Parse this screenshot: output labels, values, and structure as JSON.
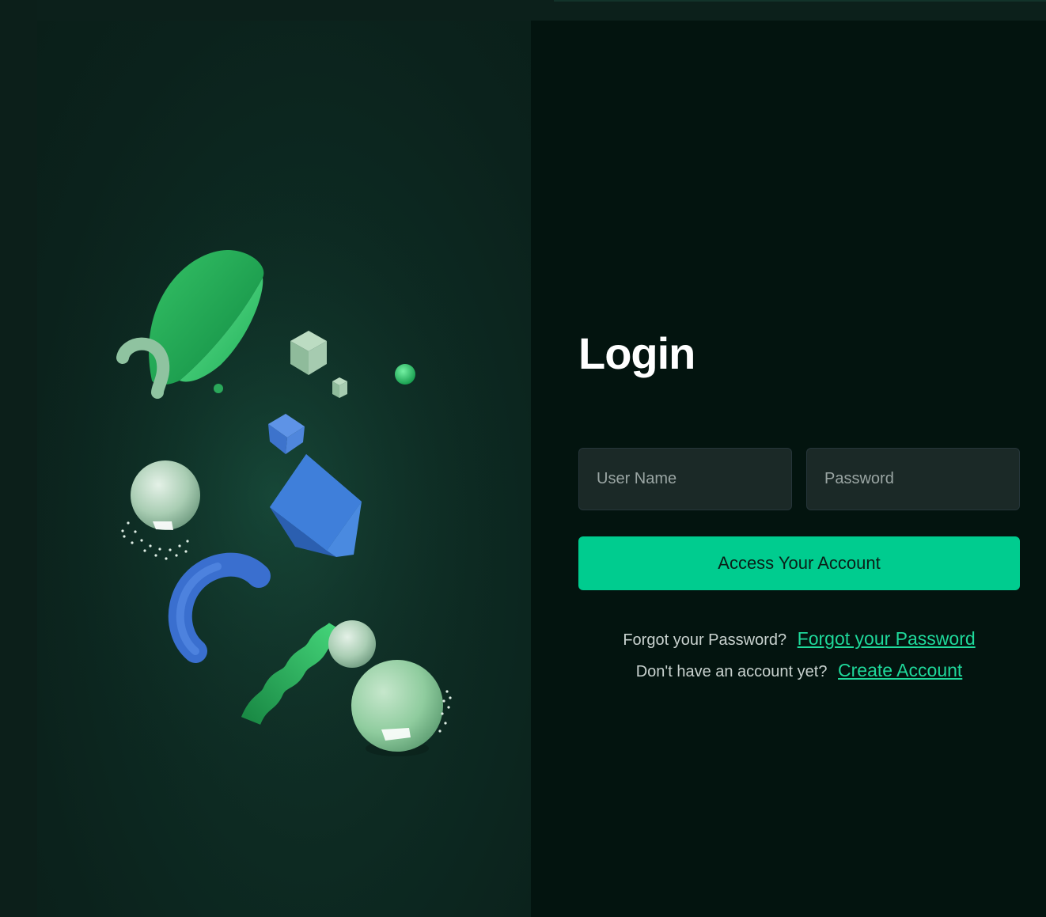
{
  "login": {
    "title": "Login",
    "username_placeholder": "User Name",
    "password_placeholder": "Password",
    "submit_label": "Access Your Account",
    "forgot_prompt": "Forgot your Password?",
    "forgot_link": "Forgot your Password",
    "signup_prompt": "Don't have an account yet?",
    "signup_link": "Create Account"
  },
  "colors": {
    "accent": "#00cc8f",
    "link": "#1fd99b",
    "background": "#03140f",
    "art_panel": "#0d2a22"
  }
}
